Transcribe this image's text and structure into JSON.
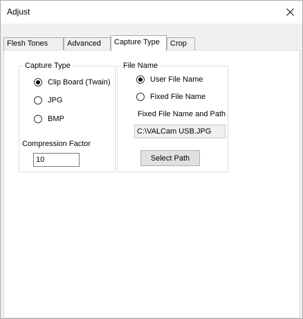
{
  "window": {
    "title": "Adjust"
  },
  "tabs": [
    {
      "label": "Flesh Tones"
    },
    {
      "label": "Advanced"
    },
    {
      "label": "Capture Type"
    },
    {
      "label": "Crop"
    }
  ],
  "capture_type": {
    "legend": "Capture Type",
    "options": [
      {
        "label": "Clip Board (Twain)",
        "checked": true
      },
      {
        "label": "JPG",
        "checked": false
      },
      {
        "label": "BMP",
        "checked": false
      }
    ],
    "compression_label": "Compression Factor",
    "compression_value": "10"
  },
  "file_name": {
    "legend": "File Name",
    "options": [
      {
        "label": "User File Name",
        "checked": true
      },
      {
        "label": "Fixed File Name",
        "checked": false
      }
    ],
    "fixed_path_label": "Fixed File Name and Path",
    "fixed_path_value": "C:\\VALCam USB.JPG",
    "select_path_label": "Select Path"
  }
}
